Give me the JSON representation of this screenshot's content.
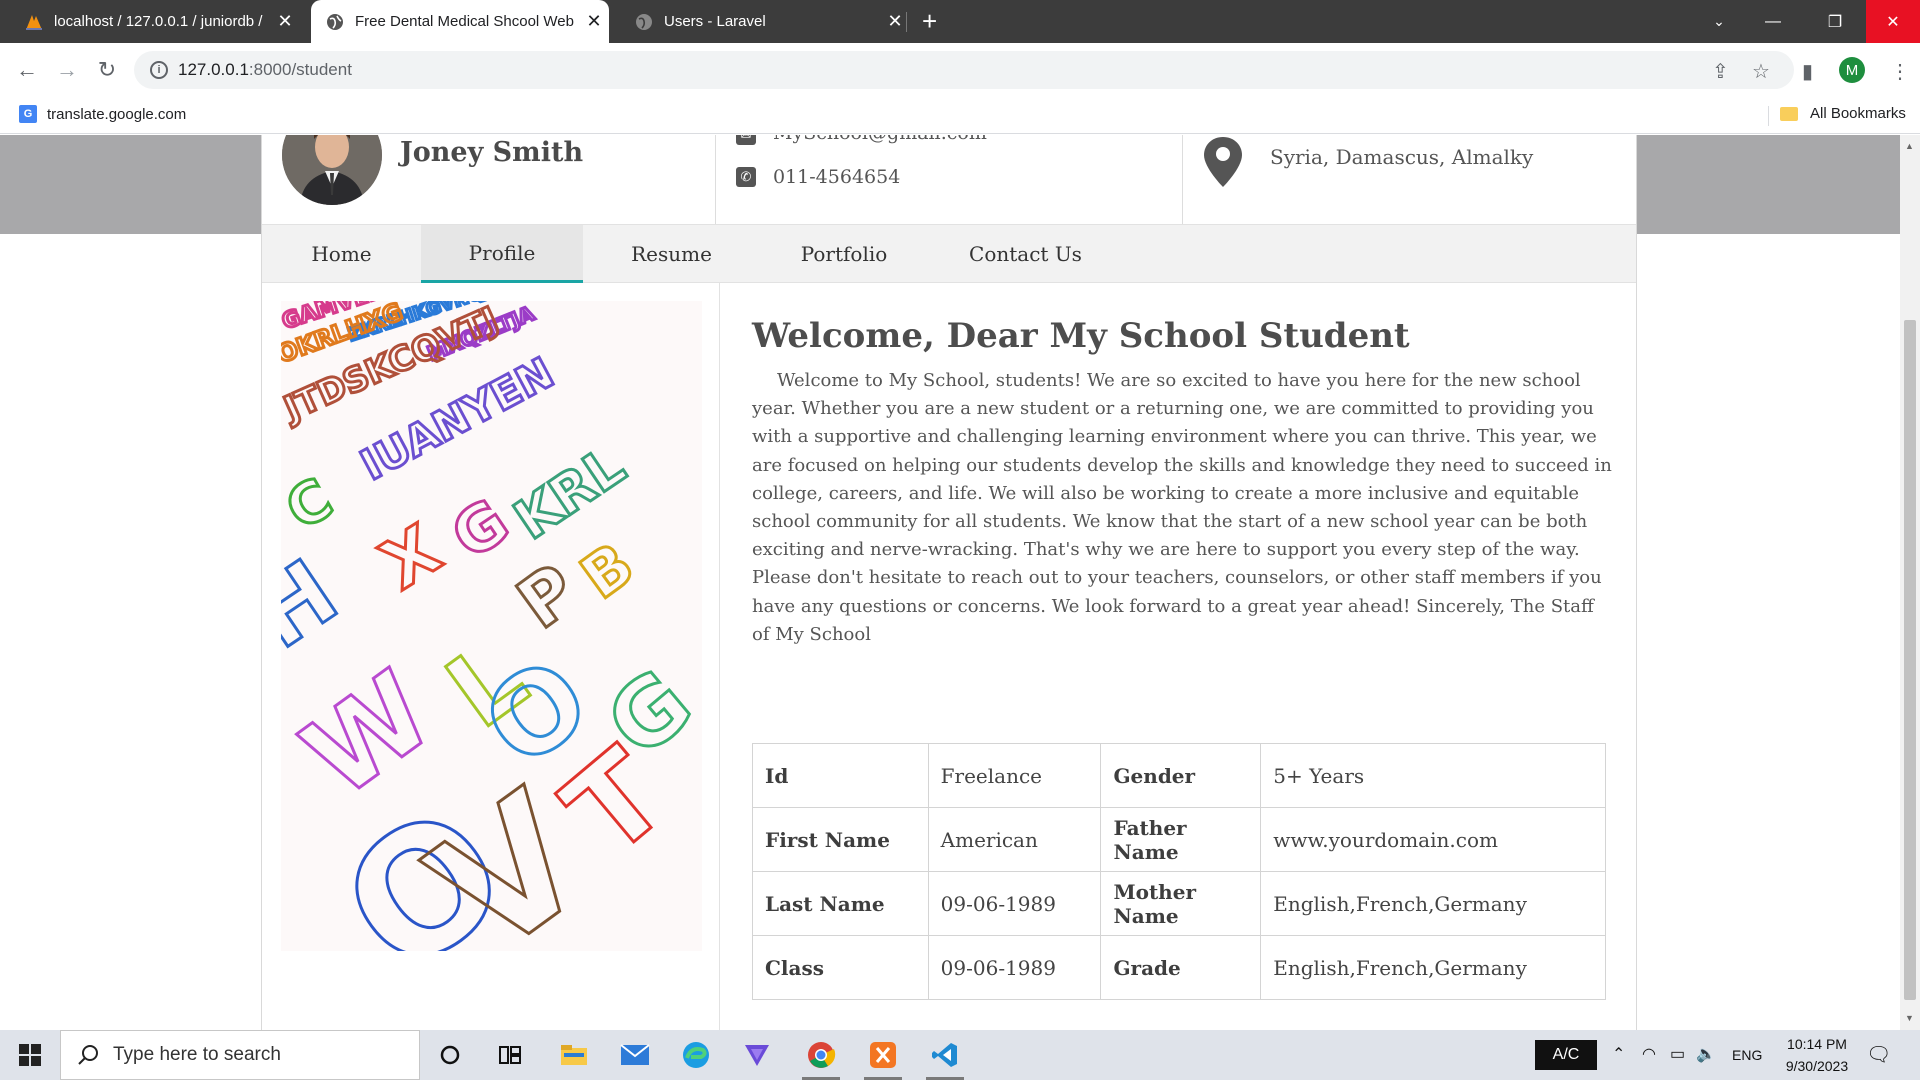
{
  "browser": {
    "tabs": [
      {
        "title": "localhost / 127.0.0.1 / juniordb /",
        "icon": "phpmyadmin-icon",
        "active": false
      },
      {
        "title": "Free Dental Medical Shcool Web",
        "icon": "globe-icon",
        "active": true
      },
      {
        "title": "Users - Laravel",
        "icon": "globe-icon",
        "active": false
      }
    ],
    "url_host": "127.0.0.1",
    "url_rest": ":8000/student",
    "profile_initial": "M",
    "bookmarks": [
      {
        "label": "translate.google.com",
        "icon": "google-translate-icon"
      }
    ],
    "all_bookmarks_label": "All Bookmarks"
  },
  "header": {
    "name": "Joney Smith",
    "email": "MySchool@gmail.com",
    "phone": "011-4564654",
    "location": "Syria, Damascus, Almalky"
  },
  "menu": [
    {
      "label": "Home",
      "active": false
    },
    {
      "label": "Profile",
      "active": true
    },
    {
      "label": "Resume",
      "active": false
    },
    {
      "label": "Portfolio",
      "active": false
    },
    {
      "label": "Contact Us",
      "active": false
    }
  ],
  "main": {
    "title": "Welcome, Dear My School Student",
    "paragraph": "Welcome to My School, students! We are so excited to have you here for the new school year. Whether you are a new student or a returning one, we are committed to providing you with a supportive and challenging learning environment where you can thrive. This year, we are focused on helping our students develop the skills and knowledge they need to succeed in college, careers, and life. We will also be working to create a more inclusive and equitable school community for all students. We know that the start of a new school year can be both exciting and nerve-wracking. That's why we are here to support you every step of the way. Please don't hesitate to reach out to your teachers, counselors, or other staff members if you have any questions or concerns. We look forward to a great year ahead! Sincerely, The Staff of My School",
    "table": [
      [
        "Id",
        "Freelance",
        "Gender",
        "5+ Years"
      ],
      [
        "First Name",
        "American",
        "Father Name",
        "www.yourdomain.com"
      ],
      [
        "Last Name",
        "09-06-1989",
        "Mother Name",
        "English,French,Germany"
      ],
      [
        "Class",
        "09-06-1989",
        "Grade",
        "English,French,Germany"
      ]
    ]
  },
  "taskbar": {
    "search_placeholder": "Type here to search",
    "ac_label": "A/C",
    "language": "ENG",
    "time": "10:14 PM",
    "date": "9/30/2023"
  },
  "colors": {
    "accent": "#1aa5a5",
    "page_band": "#a8a8aa",
    "tabstrip": "#3c3c3c",
    "close_red": "#e81123"
  }
}
